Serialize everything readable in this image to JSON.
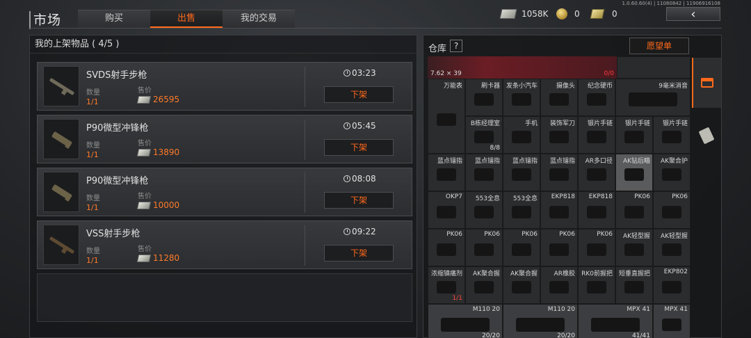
{
  "header": {
    "title": "市场",
    "tabs": [
      "购买",
      "出售",
      "我的交易"
    ],
    "active_tab": "出售",
    "version": "1.0.60.60(4) | 11080842 | 11906916108",
    "money": "1058K",
    "coins": "0",
    "bonds": "0",
    "back_icon": "‹"
  },
  "left": {
    "heading": "我的上架物品 ( 4/5 )",
    "listings": [
      {
        "name": "SVDS射手步枪",
        "qty_label": "数量",
        "qty": "1/1",
        "price_label": "售价",
        "price": "26595",
        "time": "03:23",
        "action": "下架"
      },
      {
        "name": "P90微型冲锋枪",
        "qty_label": "数量",
        "qty": "1/1",
        "price_label": "售价",
        "price": "13890",
        "time": "05:45",
        "action": "下架"
      },
      {
        "name": "P90微型冲锋枪",
        "qty_label": "数量",
        "qty": "1/1",
        "price_label": "售价",
        "price": "10000",
        "time": "08:08",
        "action": "下架"
      },
      {
        "name": "VSS射手步枪",
        "qty_label": "数量",
        "qty": "1/1",
        "price_label": "售价",
        "price": "11280",
        "time": "09:22",
        "action": "下架"
      }
    ]
  },
  "warehouse": {
    "title": "仓库",
    "help": "?",
    "wishlist": "愿望单",
    "top_caliber": "7.62 × 39",
    "top_count": "0/0",
    "items": [
      {
        "label": "万能表",
        "count": ""
      },
      {
        "label": "刷卡器",
        "count": ""
      },
      {
        "label": "发条小汽车",
        "count": ""
      },
      {
        "label": "摄像头",
        "count": ""
      },
      {
        "label": "纪念硬币",
        "count": ""
      },
      {
        "label": "9毫米消音",
        "count": ""
      },
      {
        "label": "B栋经理室",
        "count": "8/8"
      },
      {
        "label": "手机",
        "count": ""
      },
      {
        "label": "装饰军刀",
        "count": ""
      },
      {
        "label": "银片手链",
        "count": ""
      },
      {
        "label": "银片手链",
        "count": ""
      },
      {
        "label": "银片手链",
        "count": ""
      },
      {
        "label": "蓝点镭指",
        "count": ""
      },
      {
        "label": "蓝点镭指",
        "count": ""
      },
      {
        "label": "蓝点镭指",
        "count": ""
      },
      {
        "label": "蓝点镭指",
        "count": ""
      },
      {
        "label": "AR多口径",
        "count": ""
      },
      {
        "label": "AK钻后瞄",
        "count": ""
      },
      {
        "label": "AK聚合护",
        "count": ""
      },
      {
        "label": "OKP7",
        "count": ""
      },
      {
        "label": "553全息",
        "count": ""
      },
      {
        "label": "553全息",
        "count": ""
      },
      {
        "label": "EKP818",
        "count": ""
      },
      {
        "label": "EKP818",
        "count": ""
      },
      {
        "label": "PK06",
        "count": ""
      },
      {
        "label": "PK06",
        "count": ""
      },
      {
        "label": "PK06",
        "count": ""
      },
      {
        "label": "PK06",
        "count": ""
      },
      {
        "label": "PK06",
        "count": ""
      },
      {
        "label": "PK06",
        "count": ""
      },
      {
        "label": "PK06",
        "count": ""
      },
      {
        "label": "AK轻型握",
        "count": ""
      },
      {
        "label": "AK轻型握",
        "count": ""
      },
      {
        "label": "浓缩镇痛剂",
        "count": "1/1"
      },
      {
        "label": "AK聚合握",
        "count": ""
      },
      {
        "label": "AK聚合握",
        "count": ""
      },
      {
        "label": "AR橡胶",
        "count": ""
      },
      {
        "label": "RK0前握把",
        "count": ""
      },
      {
        "label": "短垂直握把",
        "count": ""
      },
      {
        "label": "EKP802",
        "count": ""
      },
      {
        "label": "M110 20",
        "count": "20/20"
      },
      {
        "label": "M110 20",
        "count": "20/20"
      },
      {
        "label": "MPX 41",
        "count": "41/41"
      },
      {
        "label": "MPX 41",
        "count": ""
      }
    ]
  }
}
